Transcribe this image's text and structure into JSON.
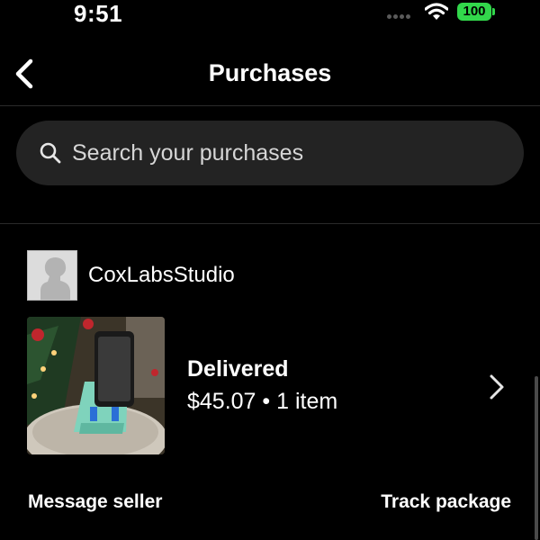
{
  "status_bar": {
    "time": "9:51",
    "battery": "100",
    "icons": [
      "signal-dots-icon",
      "wifi-icon",
      "battery-icon"
    ],
    "battery_color": "#32d74b"
  },
  "header": {
    "title": "Purchases",
    "back_icon": "chevron-left-icon"
  },
  "search": {
    "placeholder": "Search your purchases",
    "icon": "search-icon"
  },
  "purchases": [
    {
      "seller": "CoxLabsStudio",
      "status": "Delivered",
      "summary": "$45.07 • 1 item",
      "actions": {
        "message_seller": "Message seller",
        "track_package": "Track package"
      }
    }
  ],
  "colors": {
    "background": "#000000",
    "search_background": "#232323",
    "divider": "#2a2a2a"
  }
}
